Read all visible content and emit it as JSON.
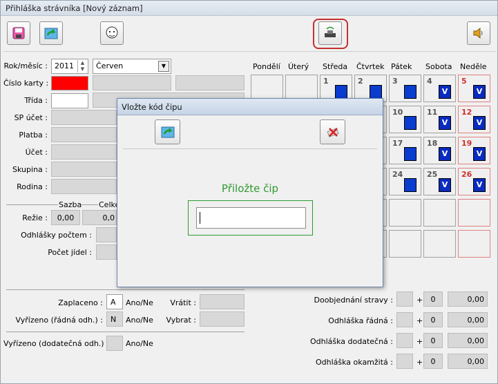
{
  "window": {
    "title": "Přihláška strávníka [Nový záznam]"
  },
  "toolbar": {
    "save": "save-icon",
    "refresh": "refresh-icon",
    "photo": "photo-icon",
    "chip": "chip-reader-icon",
    "sound": "speaker-icon"
  },
  "form": {
    "rok_mesic_label": "Rok/měsíc :",
    "year": "2011",
    "month": "Červen",
    "cislo_karty_label": "Číslo karty :",
    "trida_label": "Třída :",
    "sp_ucet_label": "SP účet :",
    "platba_label": "Platba :",
    "ucet_label": "Účet :",
    "skupina_label": "Skupina :",
    "rodina_label": "Rodina :",
    "sazba_label": "Sazba",
    "celkem_label": "Celke",
    "rezie_label": "Režie :",
    "rezie_sazba": "0,00",
    "rezie_celkem": "0,0",
    "odhlasky_poctem_label": "Odhlášky počtem :",
    "pocet_jidel_label": "Počet jídel :"
  },
  "calendar": {
    "days": [
      "Pondělí",
      "Úterý",
      "Středa",
      "Čtvrtek",
      "Pátek",
      "Sobota",
      "Neděle"
    ],
    "row1": [
      {
        "n": "1",
        "v": ""
      },
      {
        "n": "2",
        "v": ""
      },
      {
        "n": "3",
        "v": ""
      },
      {
        "n": "4",
        "v": "V"
      },
      {
        "n": "5",
        "v": "V"
      }
    ],
    "row2": [
      {
        "n": "10",
        "v": ""
      },
      {
        "n": "11",
        "v": "V"
      },
      {
        "n": "12",
        "v": "V"
      }
    ],
    "row3": [
      {
        "n": "17",
        "v": ""
      },
      {
        "n": "18",
        "v": "V"
      },
      {
        "n": "19",
        "v": "V"
      }
    ],
    "row4": [
      {
        "n": "24",
        "v": ""
      },
      {
        "n": "25",
        "v": "V"
      },
      {
        "n": "26",
        "v": "V"
      }
    ]
  },
  "payment": {
    "zaplaceno_label": "Zaplaceno :",
    "zaplaceno_value": "A",
    "zaplaceno_opts": "Ano/Ne",
    "vyrizeno_label": "Vyřízeno (řádná odh.) :",
    "vyrizeno_value": "N",
    "vyrizeno_opts": "Ano/Ne",
    "vratit_label": "Vrátit :",
    "vybrat_label": "Vybrat :",
    "vyrizeno_dod_label": "Vyřízeno (dodatečná odh.) :",
    "vyrizeno_dod_opts": "Ano/Ne"
  },
  "summary": [
    {
      "label": "Doobjednání stravy :",
      "count": "0",
      "amount": "0,00"
    },
    {
      "label": "Odhláška řádná :",
      "count": "0",
      "amount": "0,00"
    },
    {
      "label": "Odhláška dodatečná :",
      "count": "0",
      "amount": "0,00"
    },
    {
      "label": "Odhláška okamžitá :",
      "count": "0",
      "amount": "0,00"
    }
  ],
  "plus": "+",
  "dialog": {
    "title": "Vložte kód čipu",
    "prompt": "Přiložte čip",
    "input_value": ""
  },
  "colors": {
    "card_red": "#ff0000",
    "accent_green": "#2e9a2e",
    "calendar_blue": "#0a3ccf",
    "sunday_red": "#d03030"
  }
}
